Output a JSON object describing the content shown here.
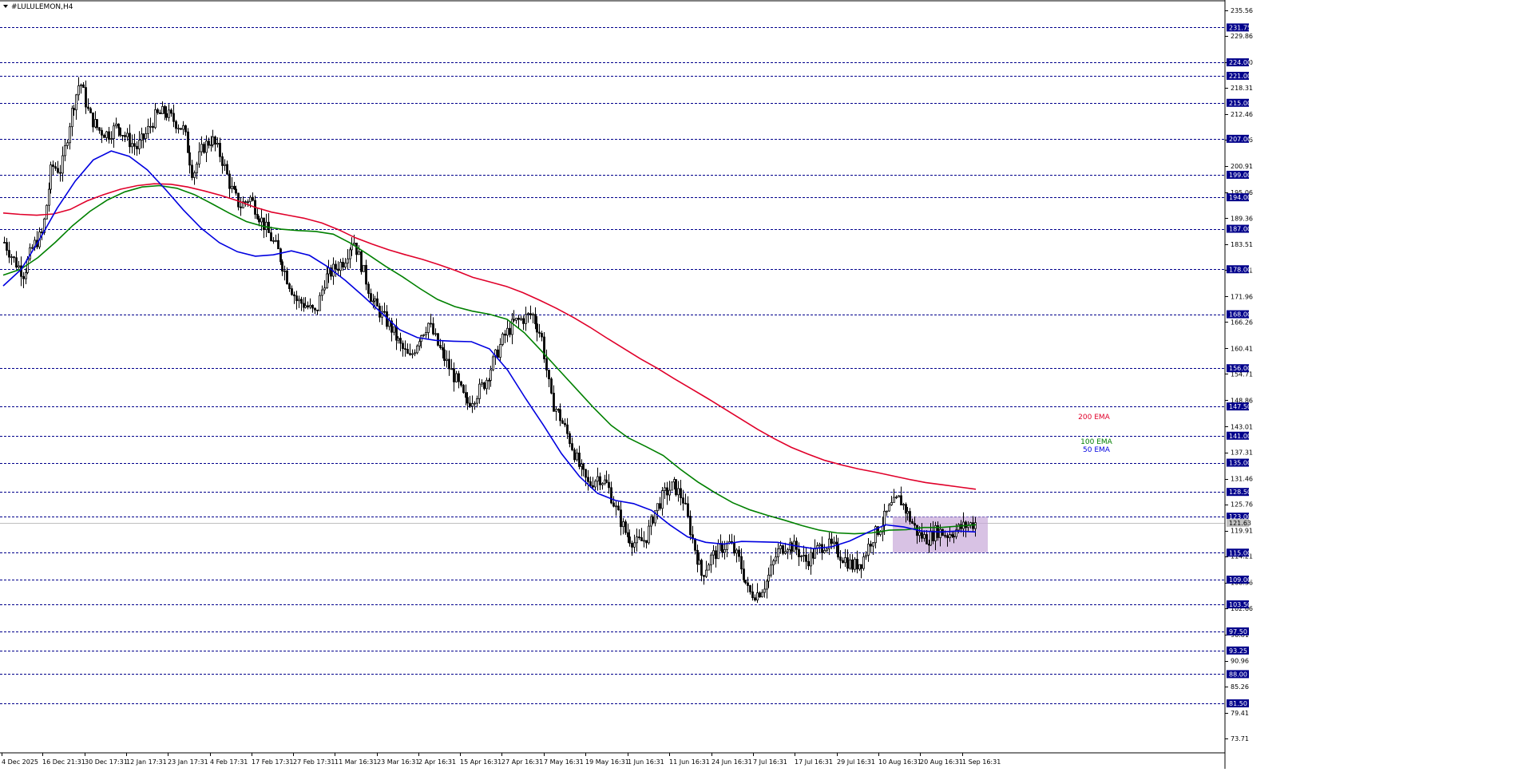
{
  "window": {
    "title": "#LULULEMON,H4",
    "menu_icon": "triangle-down-icon"
  },
  "colors": {
    "background": "#ffffff",
    "level_line": "#00008b",
    "grid": "#c0c0c0",
    "candle": "#000000",
    "ema200": "#e0002a",
    "ema100": "#008000",
    "ema50": "#0000e0",
    "range_box": "#c8a8d8",
    "axis_text": "#000000",
    "level_tag_bg": "#00008b",
    "level_tag_text": "#ffffff"
  },
  "chart_data": {
    "type": "candlestick",
    "symbol": "#LULULEMON",
    "timeframe": "H4",
    "y_axis": {
      "ylim": [
        70.5,
        237.5
      ],
      "ticks": [
        "235.56",
        "229.86",
        "224.00",
        "218.31",
        "212.46",
        "206.76",
        "200.91",
        "195.06",
        "189.36",
        "183.51",
        "177.81",
        "171.96",
        "166.26",
        "160.41",
        "154.71",
        "148.86",
        "143.01",
        "137.31",
        "131.46",
        "125.76",
        "119.91",
        "114.21",
        "108.36",
        "102.66",
        "96.81",
        "90.96",
        "85.26",
        "79.41",
        "73.71"
      ],
      "position": "right"
    },
    "x_axis": {
      "ticks": [
        "4 Dec 2025",
        "16 Dec 21:31",
        "30 Dec 17:31",
        "12 Jan 17:31",
        "23 Jan 17:31",
        "4 Feb 17:31",
        "17 Feb 17:31",
        "27 Feb 17:31",
        "11 Mar 16:31",
        "23 Mar 16:31",
        "2 Apr 16:31",
        "15 Apr 16:31",
        "27 Apr 16:31",
        "7 May 16:31",
        "19 May 16:31",
        "1 Jun 16:31",
        "11 Jun 16:31",
        "24 Jun 16:31",
        "7 Jul 16:31",
        "17 Jul 16:31",
        "29 Jul 16:31",
        "10 Aug 16:31",
        "20 Aug 16:31",
        "1 Sep 16:31"
      ]
    },
    "levels": [
      "231.75",
      "224.00",
      "221.00",
      "215.00",
      "207.00",
      "199.00",
      "194.00",
      "187.00",
      "178.00",
      "168.00",
      "156.00",
      "147.50",
      "141.00",
      "135.00",
      "128.50",
      "123.00",
      "115.00",
      "109.00",
      "103.50",
      "97.50",
      "93.25",
      "88.00",
      "81.50"
    ],
    "current_price": "121.63",
    "range_box": {
      "low": 115.0,
      "high": 123.0,
      "from": "10 Aug 16:31",
      "to": "1 Sep 16:31"
    },
    "closes": [
      184,
      180,
      177,
      183,
      186,
      201,
      200,
      212,
      220,
      212,
      209,
      208,
      210,
      207,
      205,
      208,
      212,
      213,
      211,
      209,
      199,
      205,
      207,
      203,
      196,
      192,
      194,
      190,
      186,
      182,
      176,
      171,
      170,
      168,
      176,
      178,
      180,
      185,
      178,
      171,
      168,
      165,
      161,
      158,
      163,
      166,
      161,
      157,
      153,
      148,
      150,
      153,
      158,
      163,
      166,
      167,
      168,
      163,
      149,
      145,
      140,
      134,
      130,
      132,
      130,
      124,
      119,
      117,
      118,
      124,
      128,
      130,
      127,
      118,
      110,
      114,
      116,
      117,
      113,
      106,
      106,
      109,
      115,
      117,
      116,
      113,
      115,
      117,
      116,
      114,
      112,
      113,
      118,
      121,
      125,
      127,
      123,
      119,
      118,
      120,
      119,
      120,
      121,
      121.6
    ],
    "series": [
      {
        "name": "200 EMA",
        "color": "#e0002a",
        "values": [
          190.5,
          190.2,
          190.0,
          190.3,
          191.3,
          193.2,
          194.6,
          195.8,
          196.6,
          197.0,
          196.9,
          196.3,
          195.4,
          194.4,
          193.2,
          191.8,
          190.7,
          190.0,
          189.3,
          188.3,
          186.8,
          185.0,
          183.6,
          182.3,
          181.2,
          180.2,
          179.0,
          177.7,
          176.2,
          175.2,
          174.2,
          172.8,
          171.1,
          169.3,
          167.3,
          165.1,
          162.7,
          160.4,
          158.1,
          156.0,
          153.7,
          151.5,
          149.3,
          147.0,
          144.7,
          142.4,
          140.3,
          138.4,
          136.9,
          135.5,
          134.5,
          133.6,
          132.9,
          132.1,
          131.3,
          130.6,
          130.1,
          129.6,
          129.1
        ]
      },
      {
        "name": "100 EMA",
        "color": "#008000",
        "values": [
          176.7,
          178.0,
          180.6,
          184.0,
          187.7,
          190.9,
          193.4,
          195.2,
          196.3,
          196.6,
          196.0,
          194.6,
          192.6,
          190.5,
          188.6,
          187.5,
          186.9,
          186.6,
          186.4,
          185.8,
          183.8,
          181.3,
          178.7,
          176.3,
          173.7,
          171.3,
          169.7,
          168.7,
          168.0,
          166.9,
          163.9,
          159.8,
          155.6,
          151.4,
          147.2,
          143.3,
          140.5,
          138.6,
          136.6,
          133.5,
          130.7,
          128.3,
          126.1,
          124.5,
          123.3,
          122.2,
          121.0,
          120.0,
          119.4,
          119.2,
          119.4,
          120.0,
          120.1,
          120.6,
          120.6,
          120.9,
          121.2
        ]
      },
      {
        "name": "50 EMA",
        "color": "#0000e0",
        "values": [
          174.3,
          178.0,
          184.5,
          191.6,
          197.6,
          202.3,
          204.3,
          203.1,
          200.1,
          195.8,
          191.2,
          187.1,
          183.9,
          181.9,
          180.9,
          181.2,
          182.1,
          181.1,
          178.6,
          175.5,
          172.0,
          168.3,
          164.6,
          162.8,
          162.2,
          162.0,
          161.9,
          160.3,
          155.6,
          149.3,
          143.3,
          137.0,
          131.9,
          128.2,
          126.6,
          125.9,
          124.4,
          121.2,
          118.5,
          117.3,
          116.9,
          117.5,
          117.4,
          117.3,
          116.5,
          115.9,
          116.3,
          117.6,
          119.5,
          121.2,
          120.7,
          119.8,
          119.6,
          119.8,
          119.6
        ]
      }
    ],
    "labels": [
      {
        "text": "200 EMA",
        "series": "200 EMA"
      },
      {
        "text": "100 EMA",
        "series": "100 EMA"
      },
      {
        "text": "50 EMA",
        "series": "50 EMA"
      }
    ]
  }
}
